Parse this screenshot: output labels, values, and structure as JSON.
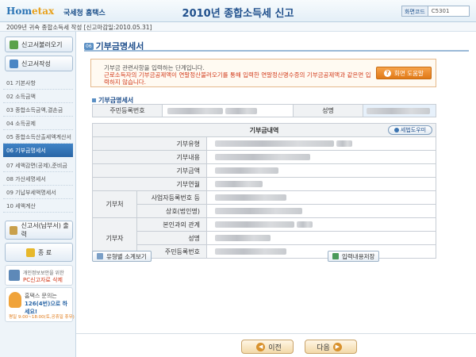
{
  "header": {
    "logo_main": "Hom",
    "logo_accent": "etax",
    "logo_sub": "국세청 홈택스",
    "brand": "국세청 홈택스",
    "title": "2010년 종합소득세 신고",
    "screen_code_label": "화면코드",
    "screen_code_value": "C5301"
  },
  "subheader": "2009년 귀속 종합소득세 작성 [신고마감일:2010.05.31]",
  "sidebar": {
    "load_button": "신고서불러오기",
    "write_button": "신고서작성",
    "items": [
      {
        "label": "01 기본사항"
      },
      {
        "label": "02 소득금액"
      },
      {
        "label": "03 종합소득금액,결손금"
      },
      {
        "label": "04 소득공제"
      },
      {
        "label": "05 종합소득산출세액계산서"
      },
      {
        "label": "06 기부금명세서"
      },
      {
        "label": "07 세액감면(공제),준비금"
      },
      {
        "label": "08 가산세명세서"
      },
      {
        "label": "09 기납부세액명세서"
      },
      {
        "label": "10 세액계산"
      }
    ],
    "print_button": "신고서(납부서) 출력",
    "exit_button": "종 료",
    "pc_line1": "개인정보보안을 위한",
    "pc_line2": "PC신고자료 삭제",
    "contact_line1": "홈택스 문의는",
    "contact_line2": "126(4번)으로 하세요!",
    "contact_hours": "평일 9:00~18:00(토,공휴일 휴무)"
  },
  "panel": {
    "num": "06",
    "title": "기부금명세서"
  },
  "notice": {
    "line1": "기부금 관련사항을 입력하는 단계입니다.",
    "line2": "근로소득자의 기부금공제액이 연말정산불러오기를 통해 입력한 연말정산명수증의 기부금공제액과 같은면 입력하지 않습니다.",
    "help_label": "화면 도움말"
  },
  "section_label": "기부금명세서",
  "id_row": {
    "id_label": "주민등록번호",
    "name_label": "성명"
  },
  "detail": {
    "caption": "기부금내역",
    "law_button": "세법도우미",
    "rows": {
      "type": "기부유형",
      "content": "기부내용",
      "amount": "기부금액",
      "year": "기부연월",
      "org_group": "기부처",
      "biz_no": "사업자등록번호 등",
      "company": "상호(법인명)",
      "donor_group": "기부자",
      "relation": "본인과의 관계",
      "donor_name": "성명",
      "donor_id": "주민등록번호"
    }
  },
  "buttons": {
    "type_view": "유형별 소계보기",
    "save": "입력내용저장",
    "prev": "이전",
    "next": "다음"
  },
  "colors": {
    "accent": "#1f4f8c",
    "active_nav": "#2a66a6",
    "notice_red": "#d23a1a",
    "help_orange": "#e07916"
  }
}
